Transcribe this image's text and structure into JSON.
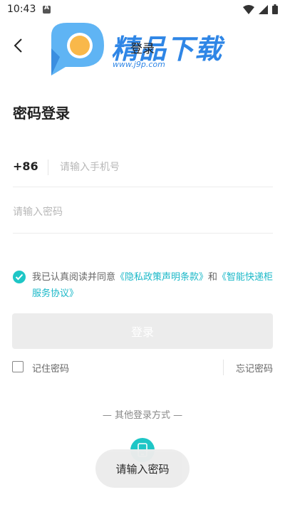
{
  "status_bar": {
    "time": "10:43",
    "icons": [
      "app-a-icon",
      "wifi-icon",
      "signal-icon",
      "battery-icon"
    ]
  },
  "header": {
    "back_icon": "chevron-left-icon",
    "title": "登录"
  },
  "watermark": {
    "text": "精品下载",
    "url": "www.j9p.com",
    "color": "#2f86e6"
  },
  "page_title": "密码登录",
  "phone": {
    "country_code": "+86",
    "placeholder": "请输入手机号",
    "value": ""
  },
  "password": {
    "placeholder": "请输入密码",
    "value": ""
  },
  "agreement": {
    "checked": true,
    "prefix": "我已认真阅读并同意",
    "privacy_link": "《隐私政策声明条款》",
    "joiner": "和",
    "service_link": "《智能快递柜服务协议》",
    "accent_color": "#1ec6c6"
  },
  "login_button": {
    "label": "登录",
    "disabled": true
  },
  "remember": {
    "label": "记住密码",
    "checked": false
  },
  "forgot_label": "忘记密码",
  "other_login_label": "— 其他登录方式 —",
  "other_login_icon": "phone-icon",
  "toast": {
    "message": "请输入密码"
  }
}
